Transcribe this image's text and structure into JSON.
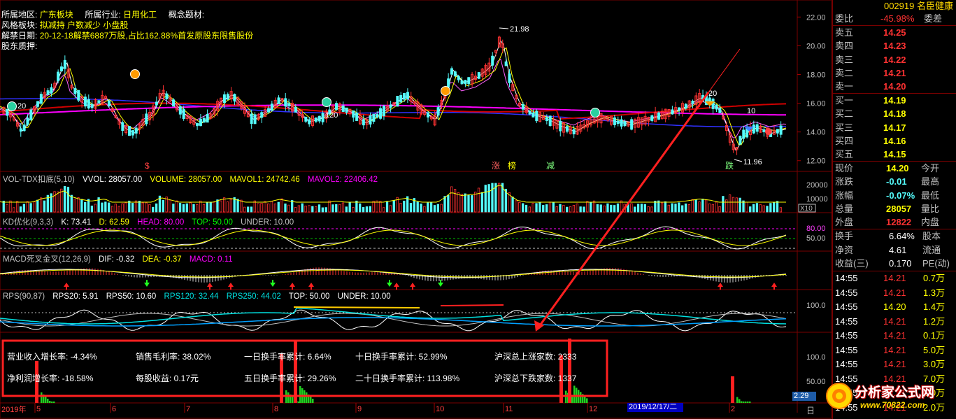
{
  "stock": {
    "code": "002919",
    "name": "名臣健康"
  },
  "info": {
    "region_label": "所属地区:",
    "region": "广东板块",
    "industry_label": "所属行业:",
    "industry": "日用化工",
    "concept_label": "概念题材:",
    "style_label": "风格板块:",
    "style": "拟减持 户数减少 小盘股",
    "unlock_label": "解禁日期:",
    "unlock": "20-12-18解禁6887万股,占比162.88%首发原股东限售股份",
    "pledge_label": "股东质押:"
  },
  "price_axis": [
    "22.00",
    "20.00",
    "18.00",
    "16.00",
    "14.00",
    "12.00"
  ],
  "price_labels": {
    "high": "21.98",
    "low": "11.96",
    "mark20": "20",
    "mark10": "10",
    "mark120": "120",
    "mark20b": "20"
  },
  "event_tags": [
    "涨",
    "榜",
    "减",
    "跌",
    "$"
  ],
  "vol_panel": {
    "title": "VOL-TDX扣底(5,10)",
    "vvol": "VVOL: 28057.00",
    "volume": "VOLUME: 28057.00",
    "mavol1": "MAVOL1: 24742.46",
    "mavol2": "MAVOL2: 22406.42",
    "axis": [
      "20000",
      "10000"
    ],
    "unit": "X10"
  },
  "kd_panel": {
    "title": "KD优化(9,3,3)",
    "k": "K: 73.41",
    "d": "D: 62.59",
    "head": "HEAD: 80.00",
    "top": "TOP: 50.00",
    "under": "UNDER: 10.00",
    "axis": [
      "80.00",
      "50.00"
    ]
  },
  "macd_panel": {
    "title": "MACD死叉金叉(12,26,9)",
    "dif": "DIF: -0.32",
    "dea": "DEA: -0.37",
    "macd": "MACD: 0.11"
  },
  "rps_panel": {
    "title": "RPS(90,87)",
    "rps20": "RPS20: 5.91",
    "rps50": "RPS50: 10.60",
    "rps120": "RPS120: 32.44",
    "rps250": "RPS250: 44.02",
    "top": "TOP: 50.00",
    "under": "UNDER: 10.00",
    "axis": [
      "100.0"
    ]
  },
  "stats_panel": {
    "axis": [
      "100.0",
      "50.00"
    ],
    "rev_growth": "营业收入增长率: -4.34%",
    "gross_margin": "销售毛利率: 38.02%",
    "turnover_1d": "一日换手率累计: 6.64%",
    "turnover_10d": "十日换手率累计: 52.99%",
    "up_count": "沪深总上涨家数: 2333",
    "profit_growth": "净利润增长率: -18.58%",
    "eps": "每股收益: 0.17元",
    "turnover_5d": "五日换手率累计: 29.26%",
    "turnover_20d": "二十日换手率累计: 113.98%",
    "down_count": "沪深总下跌家数: 1337"
  },
  "date_axis": {
    "year": "2019年",
    "months": [
      "5",
      "6",
      "7",
      "8",
      "9",
      "10",
      "11",
      "12",
      "2"
    ],
    "cursor_date": "2019/12/17/二",
    "right_val": "2.29",
    "right_tag": "日"
  },
  "quote": {
    "weibi_label": "委比",
    "weibi": "-45.98%",
    "weicha_label": "委差",
    "sell": [
      {
        "label": "卖五",
        "price": "14.25"
      },
      {
        "label": "卖四",
        "price": "14.23"
      },
      {
        "label": "卖三",
        "price": "14.22"
      },
      {
        "label": "卖二",
        "price": "14.21"
      },
      {
        "label": "卖一",
        "price": "14.20"
      }
    ],
    "buy": [
      {
        "label": "买一",
        "price": "14.19"
      },
      {
        "label": "买二",
        "price": "14.18"
      },
      {
        "label": "买三",
        "price": "14.17"
      },
      {
        "label": "买四",
        "price": "14.16"
      },
      {
        "label": "买五",
        "price": "14.15"
      }
    ],
    "stats": [
      {
        "l1": "现价",
        "v1": "14.20",
        "l2": "今开"
      },
      {
        "l1": "涨跌",
        "v1": "-0.01",
        "l2": "最高"
      },
      {
        "l1": "涨幅",
        "v1": "-0.07%",
        "l2": "最低"
      },
      {
        "l1": "总量",
        "v1": "28057",
        "l2": "量比"
      },
      {
        "l1": "外盘",
        "v1": "12822",
        "l2": "内盘"
      }
    ],
    "fin": [
      {
        "l1": "换手",
        "v1": "6.64%",
        "l2": "股本"
      },
      {
        "l1": "净资",
        "v1": "4.61",
        "l2": "流通"
      },
      {
        "l1": "收益(三)",
        "v1": "0.170",
        "l2": "PE(动)"
      }
    ],
    "ticks": [
      {
        "t": "14:55",
        "p": "14.21",
        "v": "0.7万"
      },
      {
        "t": "14:55",
        "p": "14.21",
        "v": "1.3万"
      },
      {
        "t": "14:55",
        "p": "14.20",
        "v": "1.4万"
      },
      {
        "t": "14:55",
        "p": "14.21",
        "v": "1.2万"
      },
      {
        "t": "14:55",
        "p": "14.21",
        "v": "0.1万"
      },
      {
        "t": "14:55",
        "p": "14.21",
        "v": "5.0万"
      },
      {
        "t": "14:55",
        "p": "14.21",
        "v": "3.0万"
      },
      {
        "t": "14:55",
        "p": "14.21",
        "v": "7.0万"
      },
      {
        "t": "14:55",
        "p": "14.21",
        "v": "1.0万"
      },
      {
        "t": "14:55",
        "p": "14.21",
        "v": "2.0万"
      }
    ]
  },
  "watermark": {
    "text": "分析家公式网",
    "url": "www.70822.com"
  },
  "colors": {
    "up": "#ff3232",
    "down": "#54fcfc",
    "ma5": "#ffffff",
    "ma10": "#ffff00",
    "ma20": "#ff00ff",
    "ma60": "#00cc00",
    "ma120": "#d00000",
    "ma250": "#3030ff",
    "frame": "#7a0000",
    "highlight_box": "#ff2020"
  }
}
